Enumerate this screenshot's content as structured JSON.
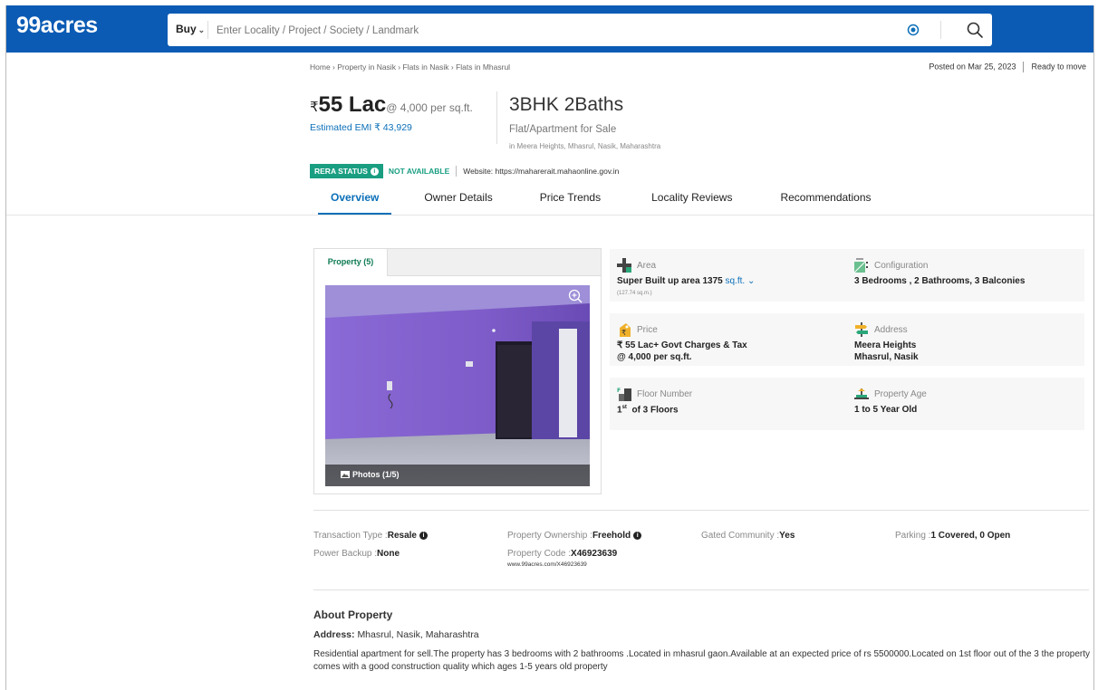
{
  "header": {
    "logo": "99acres",
    "buy_label": "Buy",
    "search_placeholder": "Enter Locality / Project / Society / Landmark"
  },
  "breadcrumb": "Home › Property in Nasik › Flats in Nasik › Flats in Mhasrul",
  "posted": {
    "date": "Posted on Mar 25, 2023",
    "status": "Ready to move"
  },
  "price": {
    "rupee": "₹",
    "amount": "55 Lac",
    "per_sqft": "@ 4,000 per sq.ft.",
    "emi": "Estimated EMI ₹ 43,929"
  },
  "title": {
    "bhk": "3BHK 2Baths",
    "type": "Flat/Apartment for Sale",
    "address": "in Meera Heights, Mhasrul, Nasik, Maharashtra"
  },
  "rera": {
    "badge": "RERA STATUS",
    "status": "NOT AVAILABLE",
    "website": "Website: https://maharerait.mahaonline.gov.in"
  },
  "tabs": [
    "Overview",
    "Owner Details",
    "Price Trends",
    "Locality Reviews",
    "Recommendations"
  ],
  "gallery": {
    "tab_label": "Property (5)",
    "photos_label": "Photos (1/5)"
  },
  "details": {
    "area": {
      "label": "Area",
      "value": "Super Built up area 1375",
      "unit": "sq.ft.",
      "sub": "(127.74 sq.m.)"
    },
    "configuration": {
      "label": "Configuration",
      "value": "3 Bedrooms , 2 Bathrooms, 3 Balconies"
    },
    "price": {
      "label": "Price",
      "value": "₹ 55 Lac+ Govt Charges & Tax",
      "value2": "@ 4,000 per sq.ft."
    },
    "address": {
      "label": "Address",
      "value": "Meera Heights",
      "value2": "Mhasrul, Nasik"
    },
    "floor": {
      "label": "Floor Number",
      "value_sup": "st",
      "value_num": "1",
      "value": "of 3 Floors"
    },
    "age": {
      "label": "Property Age",
      "value": "1 to 5 Year Old"
    }
  },
  "facts": {
    "transaction_label": "Transaction Type :",
    "transaction_value": "Resale",
    "ownership_label": "Property Ownership :",
    "ownership_value": "Freehold",
    "gated_label": "Gated Community :",
    "gated_value": "Yes",
    "parking_label": "Parking :",
    "parking_value": "1 Covered, 0 Open",
    "power_label": "Power Backup :",
    "power_value": "None",
    "code_label": "Property Code :",
    "code_value": "X46923639",
    "code_url": "www.99acres.com/X46923639"
  },
  "about": {
    "title": "About Property",
    "address_label": "Address:",
    "address_value": "Mhasrul, Nasik, Maharashtra",
    "description": "Residential apartment for sell.The property has 3 bedrooms with 2 bathrooms .Located in mhasrul gaon.Available at an expected price of rs 5500000.Located on 1st floor out of the 3 the property comes with a good construction quality which ages 1-5 years old property"
  },
  "colors": {
    "brand": "#0b5bb4",
    "accent": "#0b6fb8",
    "rera_green": "#1a9e82"
  }
}
